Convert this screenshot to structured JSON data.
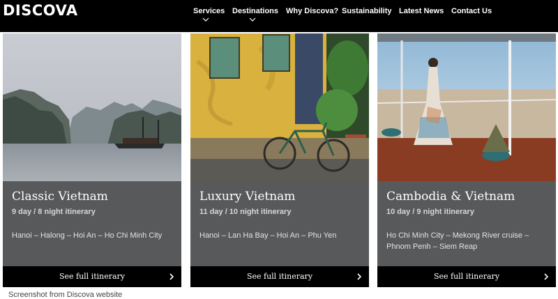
{
  "brand": {
    "logo_text": "DISCOVA"
  },
  "nav": {
    "items": [
      {
        "label": "Services",
        "has_dropdown": true
      },
      {
        "label": "Destinations",
        "has_dropdown": true
      },
      {
        "label": "Why Discova?",
        "has_dropdown": false
      },
      {
        "label": "Sustainability",
        "has_dropdown": false
      },
      {
        "label": "Latest News",
        "has_dropdown": false
      },
      {
        "label": "Contact Us",
        "has_dropdown": false
      }
    ]
  },
  "cards": [
    {
      "title": "Classic Vietnam",
      "subtitle": "9 day / 8 night itinerary",
      "route": "Hanoi – Halong – Hoi An – Ho Chi Minh City",
      "cta": "See full itinerary",
      "image": "halong-bay-junk-boat"
    },
    {
      "title": "Luxury Vietnam",
      "subtitle": "11 day / 10 night itinerary",
      "route": "Hanoi – Lan Ha Bay – Hoi An – Phu Yen",
      "cta": "See full itinerary",
      "image": "hoi-an-yellow-wall-bicycle"
    },
    {
      "title": "Cambodia & Vietnam",
      "subtitle": "10 day / 9 night itinerary",
      "route": "Ho Chi Minh City – Mekong River cruise – Phnom Penh – Siem Reap",
      "cta": "See full itinerary",
      "image": "mekong-cruise-deck"
    }
  ],
  "caption": "Screenshot from Discova website",
  "colors": {
    "nav_bg": "#000000",
    "card_bg": "#58595b",
    "cta_bg": "#000000",
    "text": "#ffffff"
  }
}
